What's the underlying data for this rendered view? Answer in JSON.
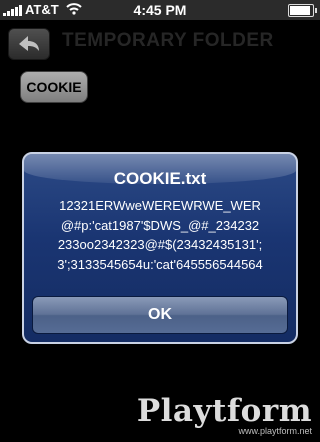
{
  "status_bar": {
    "carrier": "AT&T",
    "time": "4:45 PM",
    "wifi_icon": "wifi-icon",
    "battery_icon": "battery-icon",
    "signal_icon": "signal-bars-icon"
  },
  "nav": {
    "back_icon": "back-arrow-icon",
    "title": "TEMPORARY FOLDER"
  },
  "content": {
    "file_button_label": "COOKIE"
  },
  "alert": {
    "title": "COOKIE.txt",
    "lines": [
      "12321ERWweWEREWRWE_WER",
      "@#p:'cat1987'$DWS_@#_234232",
      "233oo2342323@#$(23432435131';",
      "3';3133545654u:'cat'645556544564"
    ],
    "button_label": "OK"
  },
  "watermark": {
    "logo": "Playtform",
    "url": "www.playtform.net"
  },
  "colors": {
    "alert_blue": "#1a3572",
    "background": "#000000"
  }
}
